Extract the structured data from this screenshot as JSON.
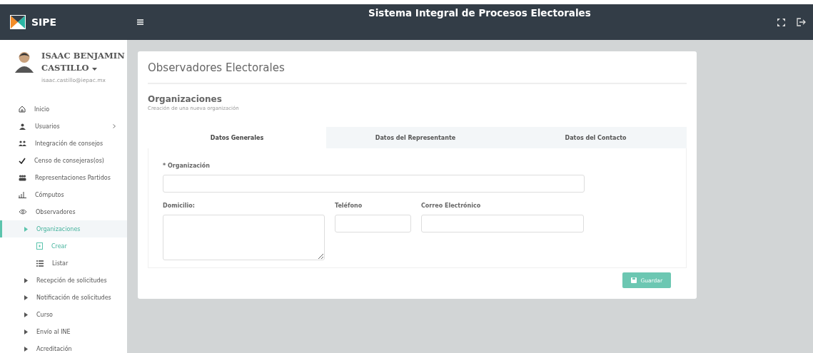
{
  "header": {
    "logo": "SIPE",
    "title": "Sistema Integral de Procesos Electorales"
  },
  "user": {
    "name": "ISAAC BENJAMIN CASTILLO",
    "email": "isaac.castillo@iepac.mx"
  },
  "sidebar": {
    "items": [
      {
        "label": "Inicio",
        "selected": false
      },
      {
        "label": "Usuarios",
        "selected": false,
        "expanded": false
      },
      {
        "label": "Integración de consejos",
        "selected": false
      },
      {
        "label": "Censo de consejeras(os)",
        "selected": false
      },
      {
        "label": "Representaciones Partidos",
        "selected": false
      },
      {
        "label": "Cómputos",
        "selected": false
      },
      {
        "label": "Observadores",
        "selected": false,
        "expanded": true,
        "children": [
          {
            "label": "Organizaciones",
            "selected": true,
            "expanded": true,
            "children": [
              {
                "label": "Crear",
                "selected": true
              },
              {
                "label": "Listar",
                "selected": false
              }
            ]
          },
          {
            "label": "Recepción de solicitudes",
            "selected": false
          },
          {
            "label": "Notificación de solicitudes",
            "selected": false
          },
          {
            "label": "Curso",
            "selected": false
          },
          {
            "label": "Envío al INE",
            "selected": false
          },
          {
            "label": "Acreditación",
            "selected": false
          }
        ]
      }
    ]
  },
  "page": {
    "title": "Observadores Electorales",
    "section": "Organizaciones",
    "subtitle": "Creación de una nueva organización"
  },
  "tabs": [
    {
      "label": "Datos Generales",
      "selected": true
    },
    {
      "label": "Datos del Representante",
      "selected": false
    },
    {
      "label": "Datos del Contacto",
      "selected": false
    }
  ],
  "form": {
    "organizacion": {
      "label": "* Organización"
    },
    "domicilio": {
      "label": "Domicilio:"
    },
    "telefono": {
      "label": "Teléfono"
    },
    "correo": {
      "label": "Correo Electrónico"
    }
  },
  "buttons": [
    {
      "label": "Guardar"
    }
  ]
}
